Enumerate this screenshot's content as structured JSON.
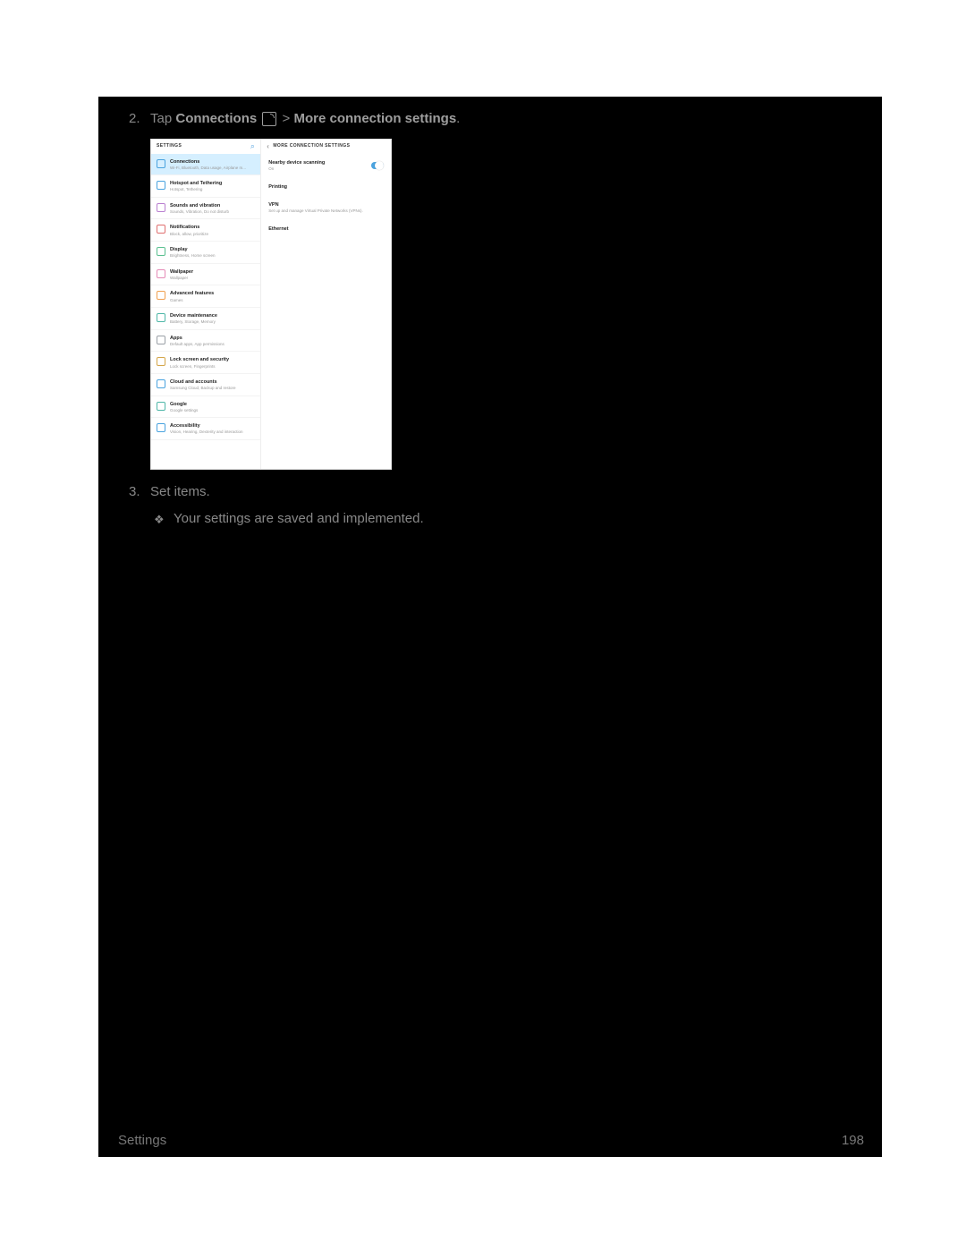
{
  "step2": {
    "pre": "Tap ",
    "bold1": "Connections",
    "mid": " > ",
    "bold2": "More connection settings",
    "post": "."
  },
  "step3": {
    "text": "Set items."
  },
  "result_bullet": "Your settings are saved and implemented.",
  "footer": {
    "left": "Settings",
    "right": "198"
  },
  "shot": {
    "left_header": "SETTINGS",
    "right_header": "MORE CONNECTION SETTINGS",
    "items": [
      {
        "t": "Connections",
        "d": "Wi-Fi, Bluetooth, Data usage, Airplane m...",
        "ic": "ic-blue",
        "active": true
      },
      {
        "t": "Hotspot and Tethering",
        "d": "Hotspot, Tethering",
        "ic": "ic-blue"
      },
      {
        "t": "Sounds and vibration",
        "d": "Sounds, Vibration, Do not disturb",
        "ic": "ic-purple"
      },
      {
        "t": "Notifications",
        "d": "Block, allow, prioritize",
        "ic": "ic-red"
      },
      {
        "t": "Display",
        "d": "Brightness, Home screen",
        "ic": "ic-green"
      },
      {
        "t": "Wallpaper",
        "d": "Wallpaper",
        "ic": "ic-pink"
      },
      {
        "t": "Advanced features",
        "d": "Games",
        "ic": "ic-orange"
      },
      {
        "t": "Device maintenance",
        "d": "Battery, Storage, Memory",
        "ic": "ic-teal"
      },
      {
        "t": "Apps",
        "d": "Default apps, App permissions",
        "ic": "ic-grey"
      },
      {
        "t": "Lock screen and security",
        "d": "Lock screen, Fingerprints",
        "ic": "ic-gold"
      },
      {
        "t": "Cloud and accounts",
        "d": "Samsung Cloud, Backup and restore",
        "ic": "ic-blue"
      },
      {
        "t": "Google",
        "d": "Google settings",
        "ic": "ic-teal"
      },
      {
        "t": "Accessibility",
        "d": "Vision, Hearing, Dexterity and interaction",
        "ic": "ic-blue"
      }
    ],
    "right_items": [
      {
        "t": "Nearby device scanning",
        "d": "On",
        "toggle": true
      },
      {
        "t": "Printing",
        "d": ""
      },
      {
        "t": "VPN",
        "d": "Set up and manage Virtual Private Networks (VPNs)."
      },
      {
        "t": "Ethernet",
        "d": ""
      }
    ]
  }
}
